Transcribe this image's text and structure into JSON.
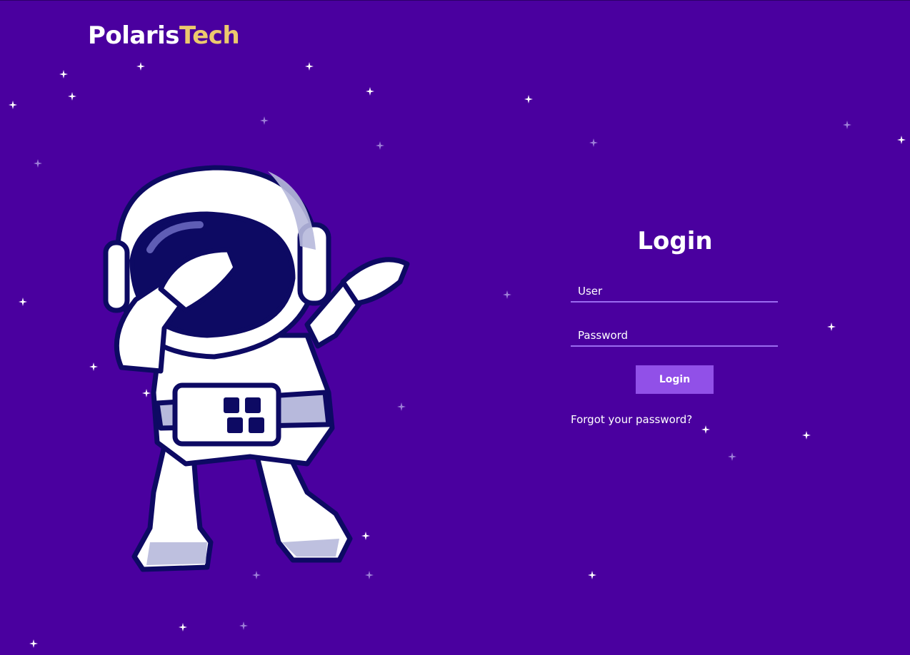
{
  "brand": {
    "part1": "Polaris",
    "part2": "Tech",
    "accent_color": "#ecc96d"
  },
  "background_color": "#4a009f",
  "illustration": {
    "name": "dabbing-astronaut-illustration"
  },
  "login": {
    "title": "Login",
    "user_placeholder": "User",
    "password_placeholder": "Password",
    "button_label": "Login",
    "button_color": "#9150e8",
    "forgot_link": "Forgot your password?"
  }
}
